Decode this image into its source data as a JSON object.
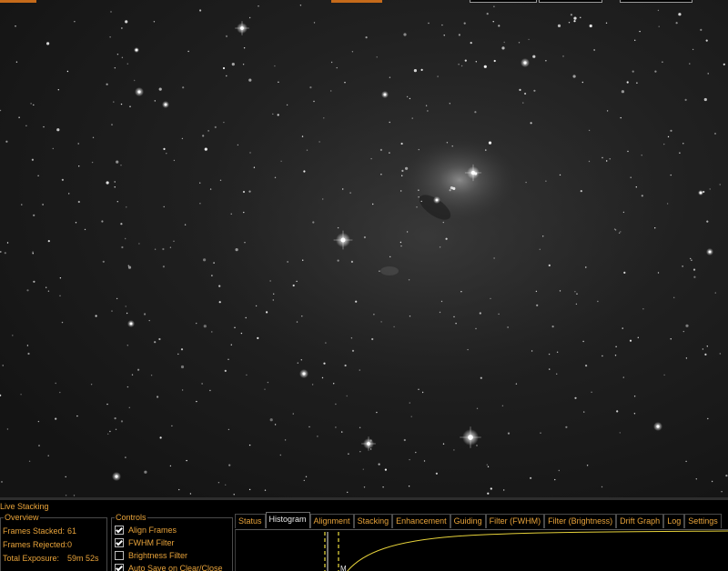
{
  "panel": {
    "title": "Live Stacking",
    "overview": {
      "legend": "Overview",
      "frames_stacked_label": "Frames Stacked:",
      "frames_stacked_value": "61",
      "frames_rejected_label": "Frames Rejected:",
      "frames_rejected_value": "0",
      "total_exposure_label": "Total Exposure:",
      "total_exposure_value": "59m 52s"
    },
    "controls": {
      "legend": "Controls",
      "items": [
        {
          "label": "Align Frames",
          "checked": true
        },
        {
          "label": "FWHM Filter",
          "checked": true
        },
        {
          "label": "Brightness Filter",
          "checked": false
        },
        {
          "label": "Auto Save on Clear/Close",
          "checked": true
        }
      ]
    },
    "tabs": [
      {
        "label": "Status",
        "active": false
      },
      {
        "label": "Histogram",
        "active": true
      },
      {
        "label": "Alignment",
        "active": false
      },
      {
        "label": "Stacking",
        "active": false
      },
      {
        "label": "Enhancement",
        "active": false
      },
      {
        "label": "Guiding",
        "active": false
      },
      {
        "label": "Filter (FWHM)",
        "active": false
      },
      {
        "label": "Filter (Brightness)",
        "active": false
      },
      {
        "label": "Drift Graph",
        "active": false
      },
      {
        "label": "Log",
        "active": false
      },
      {
        "label": "Settings",
        "active": false
      }
    ],
    "histogram_marker": "M"
  },
  "colors": {
    "accent_text": "#e8a33a",
    "histogram_curve": "#e6d23a",
    "histogram_markers": "#f0e040"
  }
}
